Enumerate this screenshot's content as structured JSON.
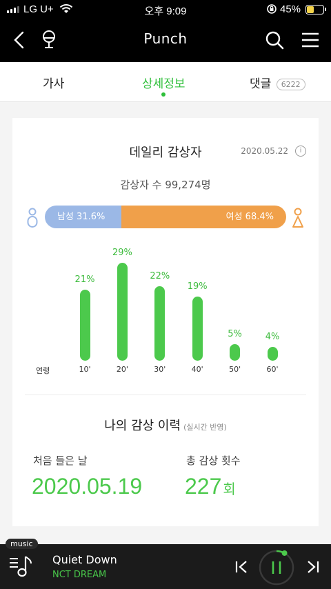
{
  "status": {
    "carrier": "LG U+",
    "time": "오후 9:09",
    "battery_pct": "45%"
  },
  "header": {
    "title": "Punch",
    "back_icon": "chevron-left-icon",
    "mic_icon": "microphone-icon",
    "search_icon": "search-icon",
    "menu_icon": "hamburger-menu-icon"
  },
  "tabs": {
    "lyrics": "가사",
    "details": "상세정보",
    "comments": "댓글",
    "comments_count": "6222",
    "active": "details"
  },
  "daily": {
    "title": "데일리 감상자",
    "date": "2020.05.22",
    "info_icon": "i",
    "listener_text": "감상자 수 99,274명",
    "male_label": "남성 31.6%",
    "female_label": "여성 68.4%",
    "male_ratio": 31.6,
    "female_ratio": 68.4,
    "colors": {
      "male": "#9bb8e6",
      "female": "#f0a04a",
      "bar": "#4cc94c"
    }
  },
  "chart_data": {
    "type": "bar",
    "xlabel": "연령",
    "categories": [
      "10'",
      "20'",
      "30'",
      "40'",
      "50'",
      "60'"
    ],
    "values": [
      21,
      29,
      22,
      19,
      5,
      4
    ],
    "value_labels": [
      "21%",
      "29%",
      "22%",
      "19%",
      "5%",
      "4%"
    ]
  },
  "history": {
    "title": "나의 감상 이력",
    "subtitle": "(실시간 반영)",
    "first_label": "처음 들은 날",
    "first_value": "2020.05.19",
    "count_label": "총 감상 횟수",
    "count_value": "227",
    "count_unit": "회"
  },
  "player": {
    "badge": "music",
    "song": "Quiet Down",
    "artist": "NCT DREAM",
    "progress": 0.08
  }
}
